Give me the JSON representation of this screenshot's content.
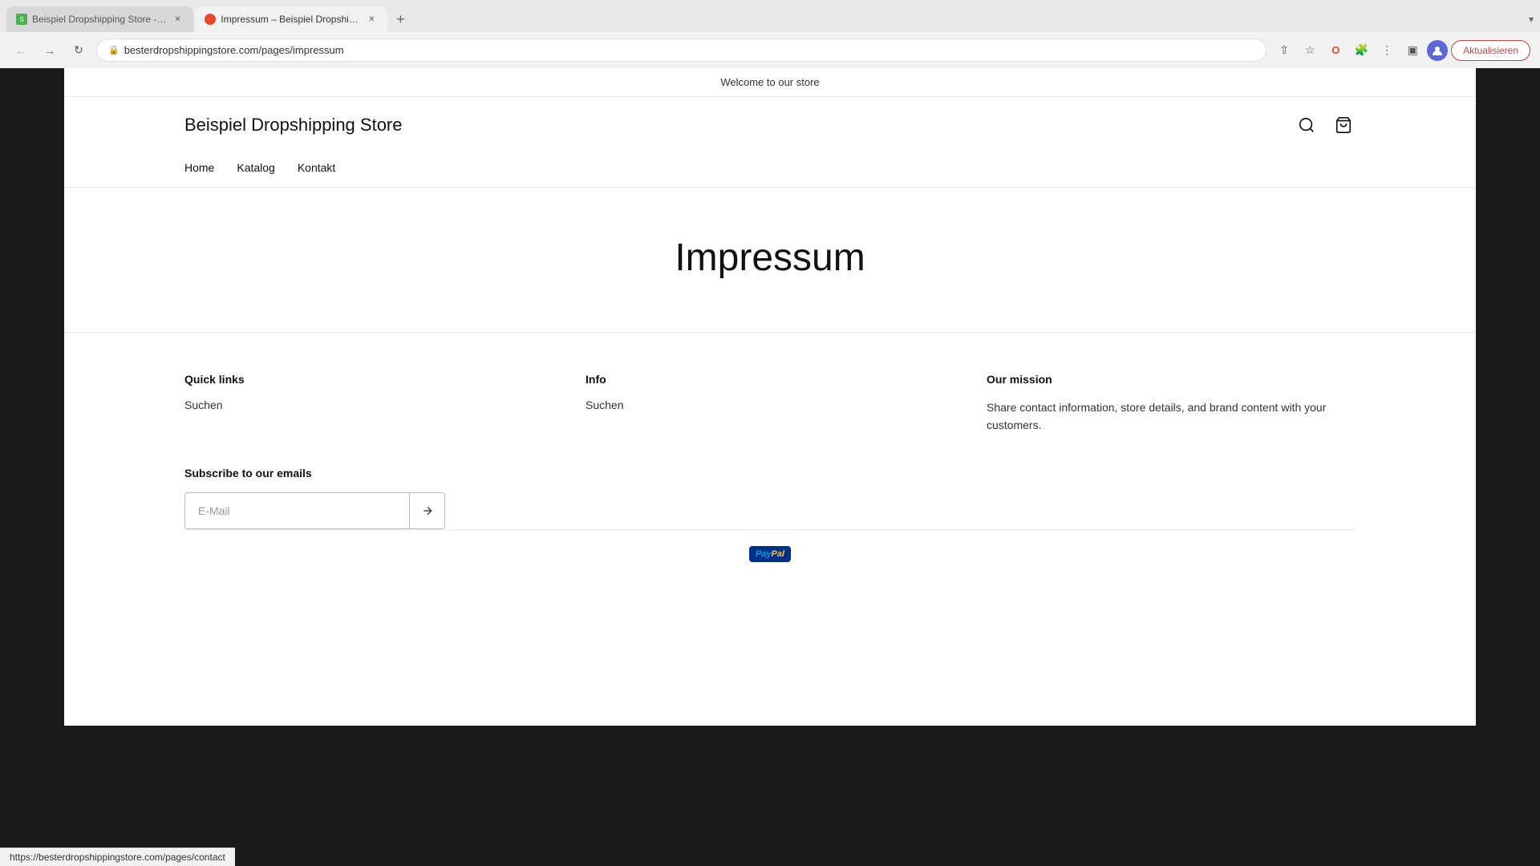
{
  "browser": {
    "tabs": [
      {
        "id": "tab1",
        "title": "Beispiel Dropshipping Store -…",
        "favicon_color": "#4CAF50",
        "favicon_type": "square",
        "active": false
      },
      {
        "id": "tab2",
        "title": "Impressum – Beispiel Dropship…",
        "favicon_color": "#e8472a",
        "favicon_type": "circle",
        "active": true
      }
    ],
    "new_tab_label": "+",
    "address": "besterdropshippingstore.com/pages/impressum",
    "address_protocol": "besterdropshippingstore.com",
    "address_path": "/pages/impressum",
    "update_button": "Aktualisieren"
  },
  "store": {
    "banner_text": "Welcome to our store",
    "logo": "Beispiel Dropshipping Store",
    "nav": [
      {
        "label": "Home",
        "href": "#"
      },
      {
        "label": "Katalog",
        "href": "#"
      },
      {
        "label": "Kontakt",
        "href": "#"
      }
    ],
    "page_title": "Impressum"
  },
  "footer": {
    "quick_links_heading": "Quick links",
    "quick_links": [
      {
        "label": "Suchen"
      }
    ],
    "info_heading": "Info",
    "info_links": [
      {
        "label": "Suchen"
      }
    ],
    "mission_heading": "Our mission",
    "mission_text": "Share contact information, store details, and brand content with your customers.",
    "subscribe_heading": "Subscribe to our emails",
    "email_placeholder": "E-Mail",
    "paypal_text": "PayPal"
  },
  "status_bar": {
    "url": "https://besterdropshippingstore.com/pages/contact"
  }
}
